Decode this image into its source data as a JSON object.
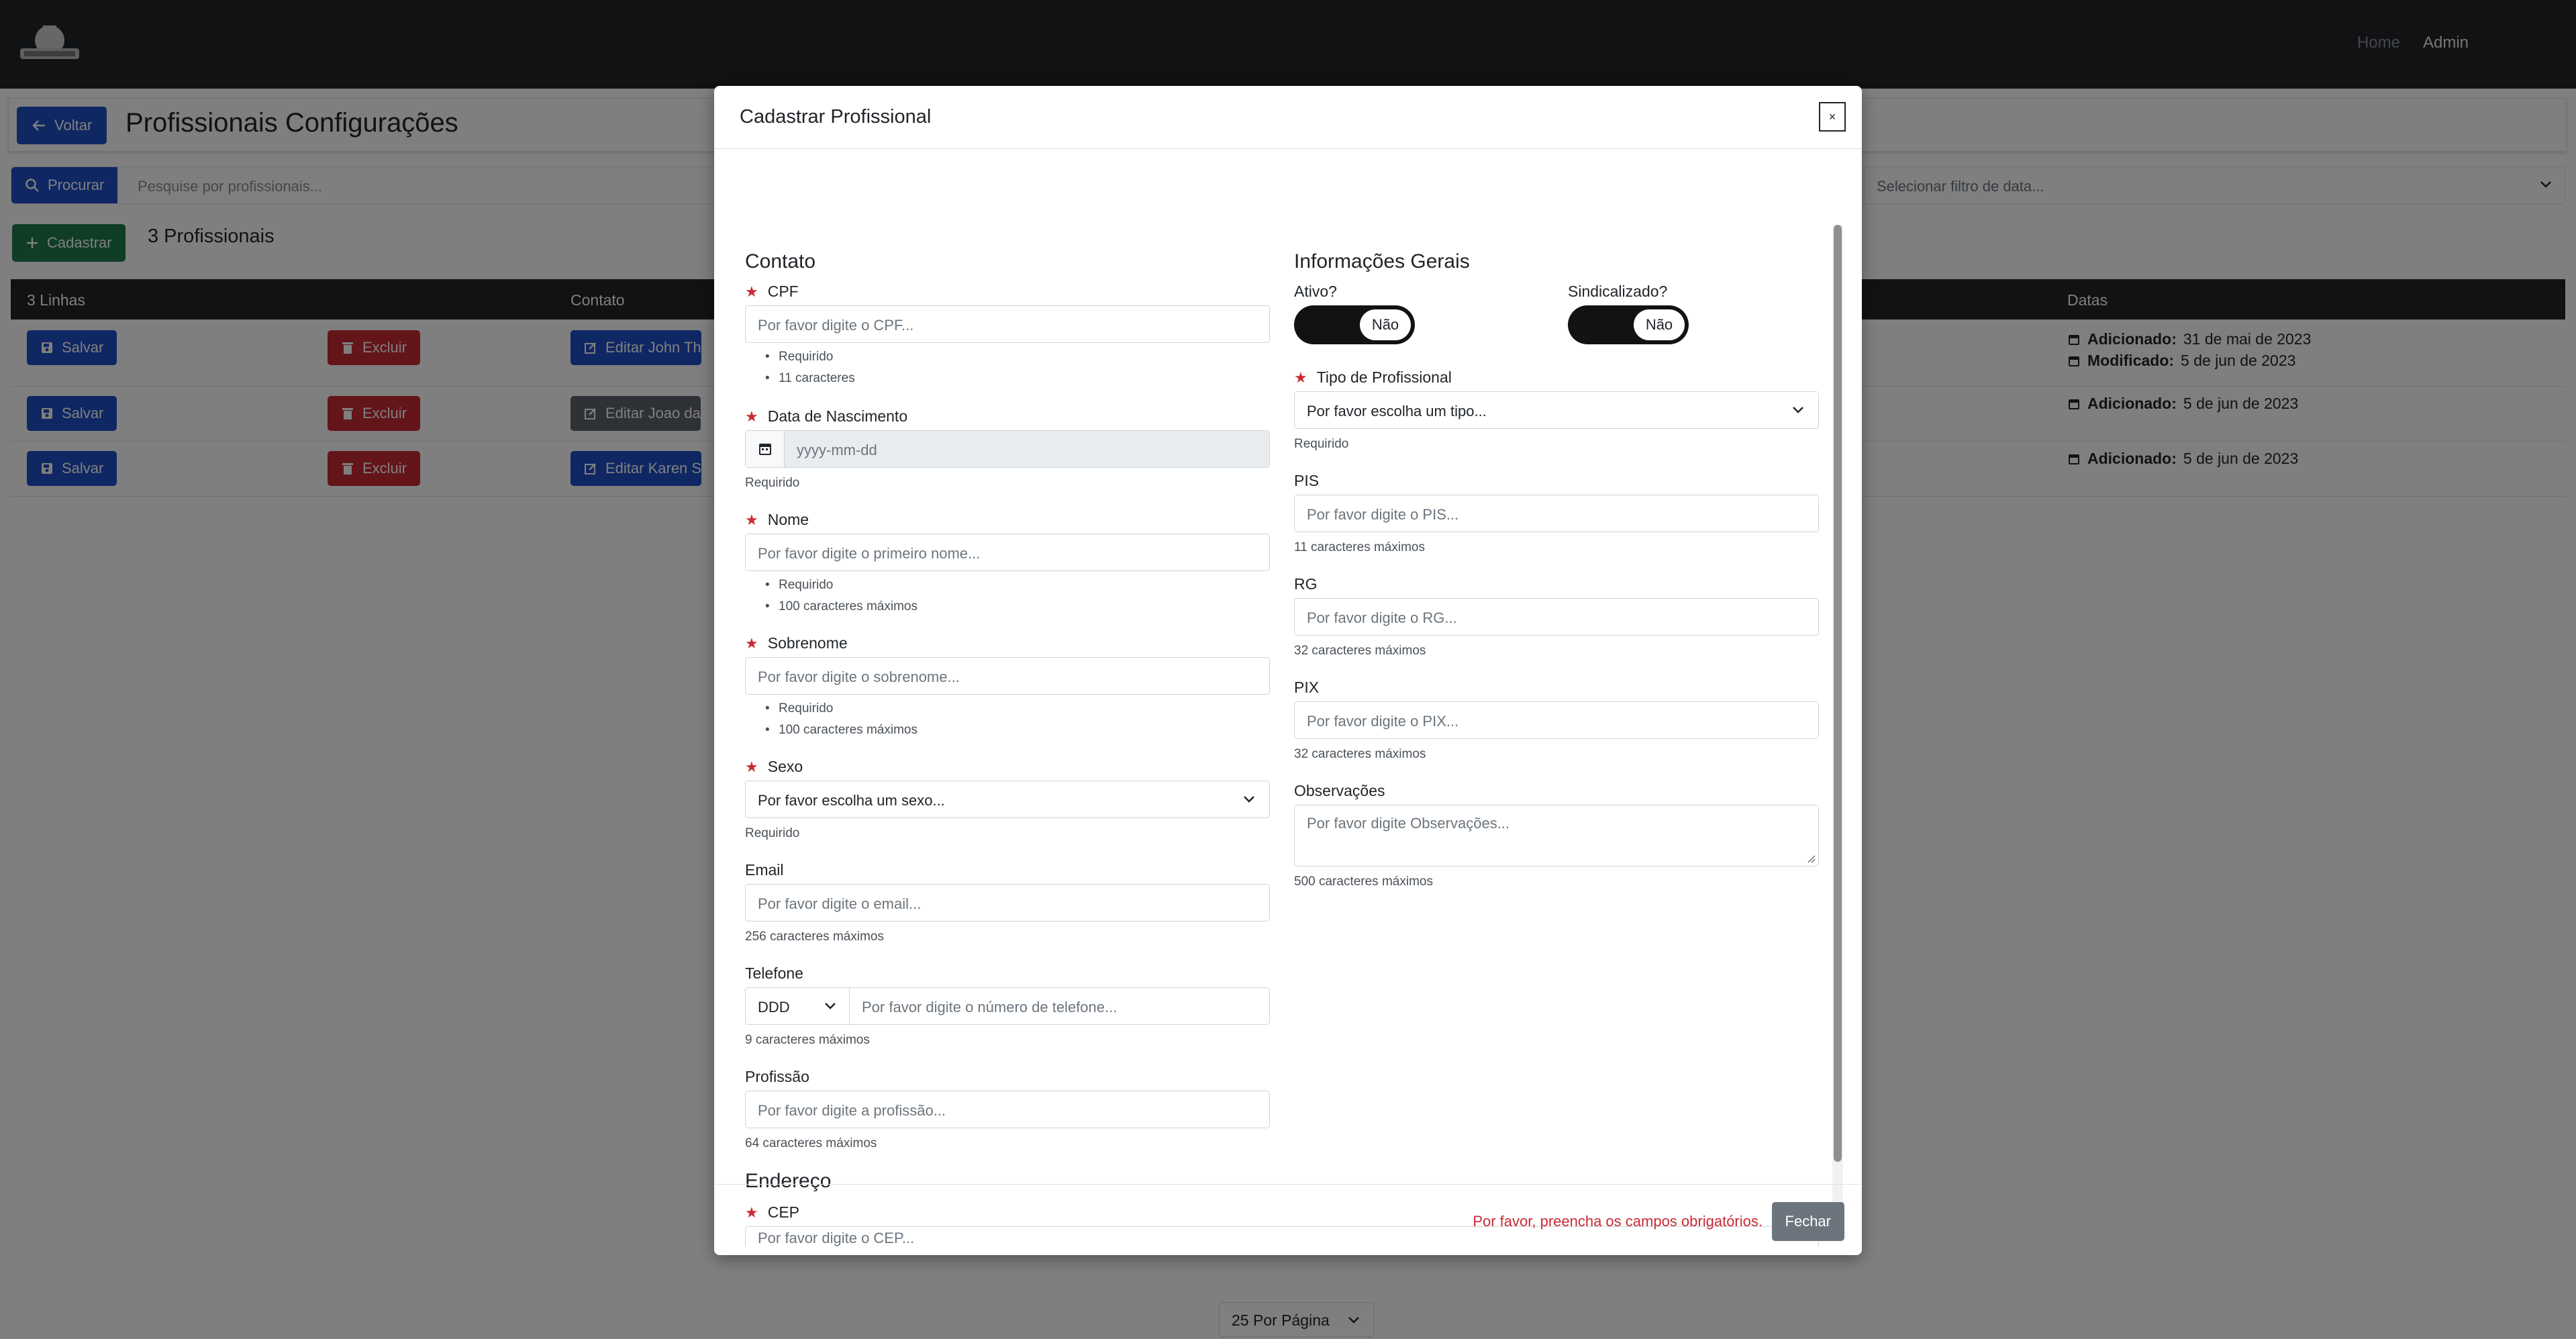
{
  "navbar": {
    "logo_alt": "SINPROESO",
    "links": [
      "Home",
      "Admin"
    ]
  },
  "page": {
    "back_label": "Voltar",
    "title": "Profissionais Configurações",
    "search_button": "Procurar",
    "search_placeholder": "Pesquise por profissionais...",
    "date_filter_placeholder": "Selecionar filtro de data...",
    "add_button": "Cadastrar",
    "count_label": "3 Profissionais",
    "table": {
      "headers": [
        "3 Linhas",
        "Contato",
        "Datas"
      ],
      "rows": [
        {
          "save": "Salvar",
          "delete": "Excluir",
          "edit": "Editar John Th",
          "dates": [
            {
              "label": "Adicionado:",
              "value": "31 de mai de 2023"
            },
            {
              "label": "Modificado:",
              "value": "5 de jun de 2023"
            }
          ]
        },
        {
          "save": "Salvar",
          "delete": "Excluir",
          "edit": "Editar Joao da",
          "dates": [
            {
              "label": "Adicionado:",
              "value": "5 de jun de 2023"
            }
          ]
        },
        {
          "save": "Salvar",
          "delete": "Excluir",
          "edit": "Editar Karen S",
          "dates": [
            {
              "label": "Adicionado:",
              "value": "5 de jun de 2023"
            }
          ]
        }
      ]
    },
    "page_size": "25 Por Página"
  },
  "modal": {
    "title": "Cadastrar Profissional",
    "close_label": "×",
    "contato": {
      "section": "Contato",
      "cpf": {
        "label": "CPF",
        "placeholder": "Por favor digite o CPF...",
        "hints": [
          "Requirido",
          "11 caracteres"
        ]
      },
      "nascimento": {
        "label": "Data de Nascimento",
        "placeholder": "yyyy-mm-dd",
        "hint": "Requirido"
      },
      "nome": {
        "label": "Nome",
        "placeholder": "Por favor digite o primeiro nome...",
        "hints": [
          "Requirido",
          "100 caracteres máximos"
        ]
      },
      "sobrenome": {
        "label": "Sobrenome",
        "placeholder": "Por favor digite o sobrenome...",
        "hints": [
          "Requirido",
          "100 caracteres máximos"
        ]
      },
      "sexo": {
        "label": "Sexo",
        "placeholder": "Por favor escolha um sexo...",
        "hint": "Requirido"
      },
      "email": {
        "label": "Email",
        "placeholder": "Por favor digite o email...",
        "hint": "256 caracteres máximos"
      },
      "telefone": {
        "label": "Telefone",
        "ddd": "DDD",
        "placeholder": "Por favor digite o número de telefone...",
        "hint": "9 caracteres máximos"
      },
      "profissao": {
        "label": "Profissão",
        "placeholder": "Por favor digite a profissão...",
        "hint": "64 caracteres máximos"
      }
    },
    "endereco": {
      "section": "Endereço",
      "cep": {
        "label": "CEP",
        "placeholder": "Por favor digite o CEP..."
      }
    },
    "gerais": {
      "section": "Informações Gerais",
      "ativo": {
        "label": "Ativo?",
        "value": "Não"
      },
      "sindicalizado": {
        "label": "Sindicalizado?",
        "value": "Não"
      },
      "tipo": {
        "label": "Tipo de Profissional",
        "placeholder": "Por favor escolha um tipo...",
        "hint": "Requirido"
      },
      "pis": {
        "label": "PIS",
        "placeholder": "Por favor digite o PIS...",
        "hint": "11 caracteres máximos"
      },
      "rg": {
        "label": "RG",
        "placeholder": "Por favor digite o RG...",
        "hint": "32 caracteres máximos"
      },
      "pix": {
        "label": "PIX",
        "placeholder": "Por favor digite o PIX...",
        "hint": "32 caracteres máximos"
      },
      "observacoes": {
        "label": "Observações",
        "placeholder": "Por favor digite Observações...",
        "hint": "500 caracteres máximos"
      }
    },
    "footer": {
      "message": "Por favor, preencha os campos obrigatórios.",
      "close_button": "Fechar"
    }
  }
}
